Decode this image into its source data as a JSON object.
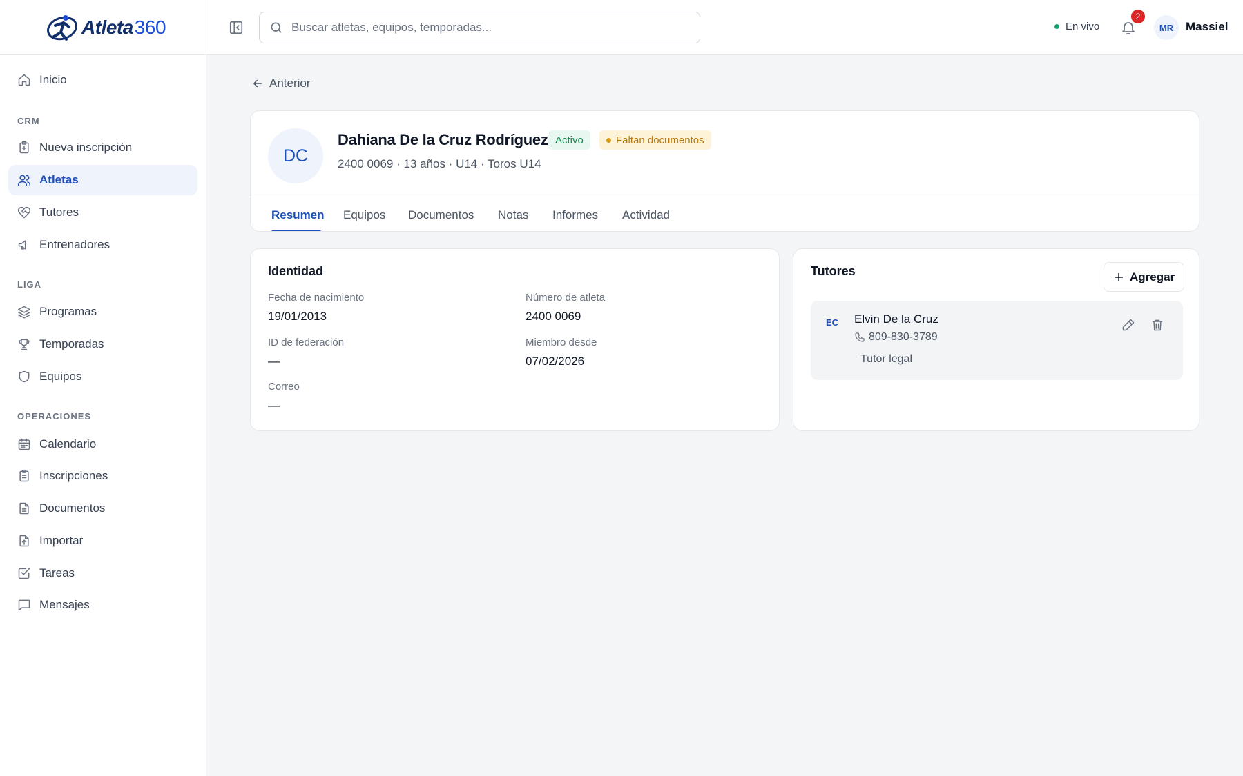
{
  "brand": {
    "name": "Atleta",
    "number": "360"
  },
  "sidebar": {
    "items": [
      {
        "label": "Inicio",
        "icon": "home-icon"
      },
      {
        "label": "Nueva inscripción",
        "icon": "clipboard-plus-icon"
      },
      {
        "label": "Atletas",
        "icon": "users-icon"
      },
      {
        "label": "Tutores",
        "icon": "heart-handshake-icon"
      },
      {
        "label": "Entrenadores",
        "icon": "megaphone-icon"
      },
      {
        "label": "Programas",
        "icon": "layers-icon"
      },
      {
        "label": "Temporadas",
        "icon": "trophy-icon"
      },
      {
        "label": "Equipos",
        "icon": "shield-icon"
      },
      {
        "label": "Calendario",
        "icon": "calendar-icon"
      },
      {
        "label": "Inscripciones",
        "icon": "clipboard-icon"
      },
      {
        "label": "Documentos",
        "icon": "document-icon"
      },
      {
        "label": "Importar",
        "icon": "file-upload-icon"
      },
      {
        "label": "Tareas",
        "icon": "check-square-icon"
      },
      {
        "label": "Mensajes",
        "icon": "message-icon"
      }
    ],
    "sections": {
      "crm": "CRM",
      "liga": "LIGA",
      "operaciones": "OPERACIONES"
    },
    "active": "Atletas"
  },
  "header": {
    "search_placeholder": "Buscar atletas, equipos, temporadas...",
    "live_label": "En vivo",
    "notification_count": "2",
    "user_initials": "MR",
    "user_name": "Massiel"
  },
  "back_label": "Anterior",
  "profile": {
    "initials": "DC",
    "name": "Dahiana De la Cruz Rodríguez",
    "status": "Activo",
    "warning": "Faltan documentos",
    "subtitle": "2400 0069 · 13 años · U14 · Toros U14"
  },
  "tabs": [
    "Resumen",
    "Equipos",
    "Documentos",
    "Notas",
    "Informes",
    "Actividad"
  ],
  "active_tab": "Resumen",
  "identity": {
    "title": "Identidad",
    "birth_label": "Fecha de nacimiento",
    "birth_value": "19/01/2013",
    "athlete_number_label": "Número de atleta",
    "athlete_number_value": "2400 0069",
    "federation_label": "ID de federación",
    "federation_value": "—",
    "member_since_label": "Miembro desde",
    "member_since_value": "07/02/2026",
    "email_label": "Correo",
    "email_value": "—"
  },
  "tutors": {
    "title": "Tutores",
    "add_label": "Agregar",
    "items": [
      {
        "initials": "EC",
        "name": "Elvin De la Cruz",
        "phone": "809-830-3789",
        "role": "Tutor legal"
      }
    ]
  },
  "colors": {
    "accent": "#1e4fb5",
    "active_bg": "#eef3fc",
    "success": "#128a4f",
    "warning": "#b7790c",
    "danger": "#dc2626"
  }
}
